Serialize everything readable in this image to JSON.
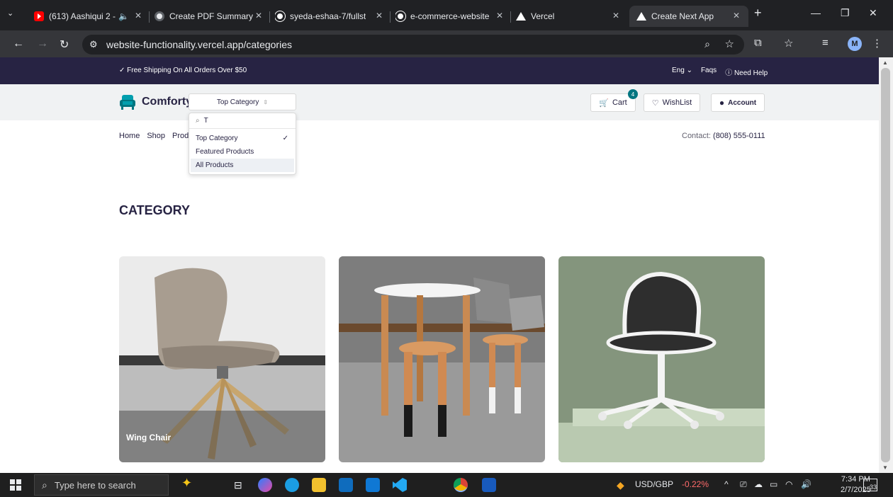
{
  "browser": {
    "tabs": [
      {
        "label": "(613) Aashiqui 2 - ",
        "icon": "youtube-icon"
      },
      {
        "label": "Create PDF Summary",
        "icon": "chatpdf-icon"
      },
      {
        "label": "syeda-eshaa-7/fullst",
        "icon": "github-icon"
      },
      {
        "label": "e-commerce-website",
        "icon": "github-icon"
      },
      {
        "label": "Vercel",
        "icon": "vercel-icon"
      },
      {
        "label": "Create Next App",
        "icon": "vercel-icon",
        "active": true
      }
    ],
    "url": "website-functionality.vercel.app/categories",
    "profile_initial": "M"
  },
  "topstrip": {
    "shipping": "✓ Free Shipping On All Orders Over $50",
    "lang": "Eng ⌄",
    "faqs": "Faqs",
    "help": "ⓘ Need Help"
  },
  "header": {
    "logo": "Comforty",
    "category_select": "Top Category",
    "cart_label": "Cart",
    "cart_count": "4",
    "wishlist_label": "WishList",
    "account_label": "Account"
  },
  "dropdown": {
    "search_value": "T",
    "items": [
      {
        "label": "Top Category",
        "selected": true
      },
      {
        "label": "Featured Products"
      },
      {
        "label": "All Products",
        "hovered": true
      }
    ]
  },
  "nav": {
    "links": [
      "Home",
      "Shop",
      "Prod"
    ],
    "contact_label": "Contact:",
    "contact_phone": "(808) 555-0111"
  },
  "page": {
    "heading": "CATEGORY",
    "cards": [
      {
        "caption": "Wing Chair"
      },
      {
        "caption": ""
      },
      {
        "caption": ""
      }
    ]
  },
  "taskbar": {
    "search_placeholder": "Type here to search",
    "ticker": "USD/GBP",
    "ticker_change": "-0.22%",
    "time": "7:34 PM",
    "date": "2/7/2025",
    "notifications": "33"
  },
  "colors": {
    "brand_dark": "#272343",
    "brand_teal": "#007580",
    "ticker_negative": "#ff6b6b"
  }
}
